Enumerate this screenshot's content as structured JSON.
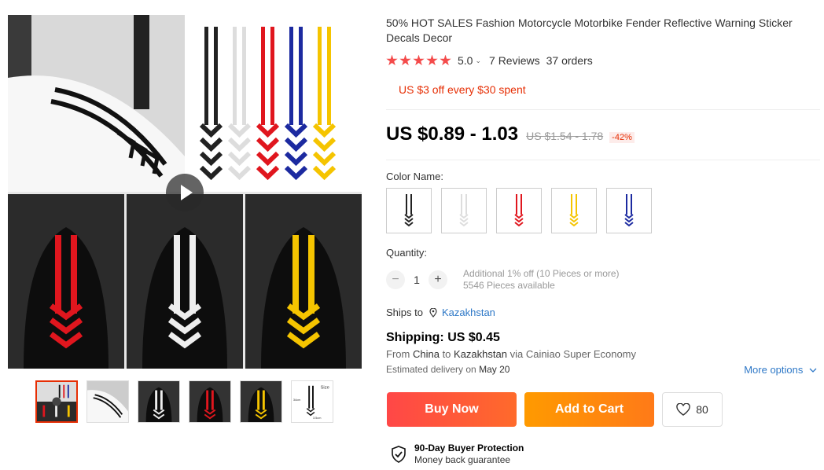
{
  "product": {
    "title": "50% HOT SALES Fashion Motorcycle Motorbike Fender Reflective Warning Sticker Decals Decor",
    "rating": "5.0",
    "rating_caret": "⌄",
    "reviews": "7 Reviews",
    "orders": "37 orders",
    "coupon": "US $3 off every $30 spent",
    "price": "US $0.89 - 1.03",
    "original_price": "US $1.54 - 1.78",
    "discount": "-42%"
  },
  "color": {
    "label": "Color Name:",
    "options": [
      {
        "name": "Black",
        "hex": "#222222"
      },
      {
        "name": "White",
        "hex": "#dddddd"
      },
      {
        "name": "Red",
        "hex": "#e0161e"
      },
      {
        "name": "Yellow",
        "hex": "#f5c400"
      },
      {
        "name": "Blue",
        "hex": "#1c2aa0"
      }
    ]
  },
  "quantity": {
    "label": "Quantity:",
    "value": "1",
    "minus": "−",
    "plus": "+",
    "additional": "Additional 1% off (10 Pieces or more)",
    "available": "5546 Pieces available"
  },
  "shipping": {
    "ships_to_label": "Ships to",
    "destination": "Kazakhstan",
    "title": "Shipping: US $0.45",
    "from_prefix": "From",
    "from_country": "China",
    "to_word": "to",
    "to_country": "Kazakhstan",
    "via": "via Cainiao Super Economy",
    "delivery_prefix": "Estimated delivery on",
    "delivery_date": "May 20",
    "more_options": "More options"
  },
  "actions": {
    "buy_now": "Buy Now",
    "add_to_cart": "Add to Cart",
    "wishlist_count": "80"
  },
  "protection": {
    "title": "90-Day Buyer Protection",
    "subtitle": "Money back guarantee"
  },
  "gallery": {
    "thumb_size_label": "Size",
    "thumb_dim_a": "34cm",
    "thumb_dim_b": "3.5cm"
  },
  "colors": {
    "accent": "#e62e04",
    "star": "#f44b4b",
    "link": "#2e78c7",
    "buy": "#ff4747",
    "cart": "#ff9a00"
  }
}
